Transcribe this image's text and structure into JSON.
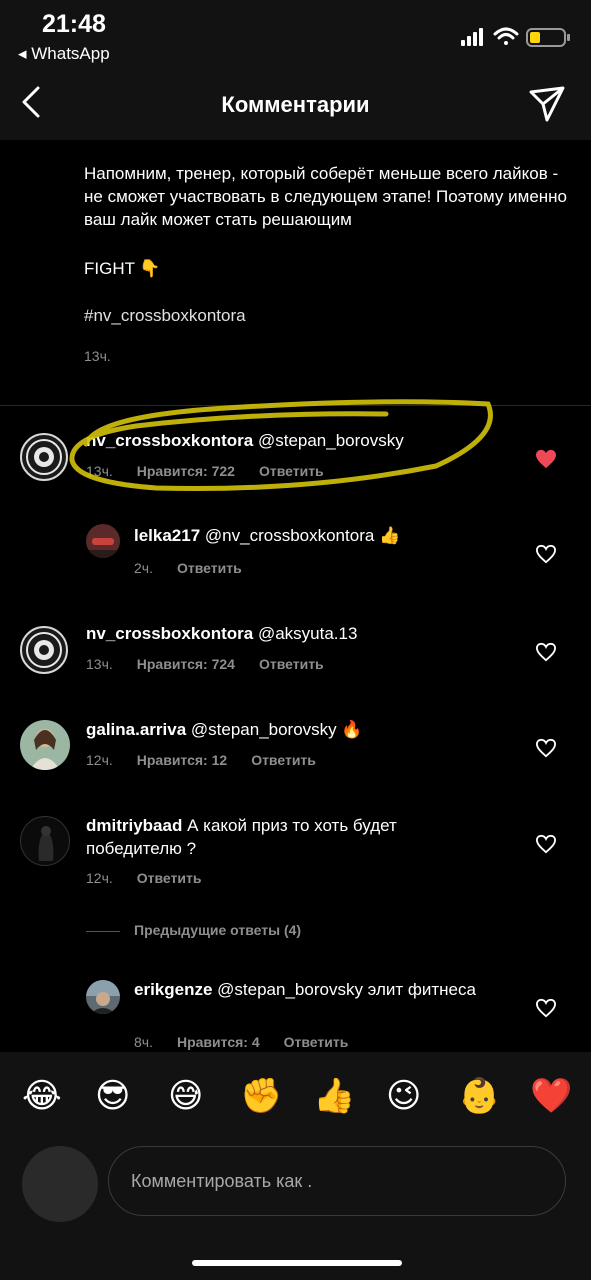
{
  "status_bar": {
    "time": "21:48",
    "back_app": "◂ WhatsApp"
  },
  "nav": {
    "title": "Комментарии"
  },
  "caption": {
    "text": "Напомним, тренер, который соберёт меньше всего лайков - не сможет участвовать в следующем этапе! Поэтому именно ваш лайк может стать решающим",
    "fight": "FIGHT 👇",
    "hashtag": "#nv_crossboxkontora",
    "time": "13ч."
  },
  "comments": [
    {
      "user": "nv_crossboxkontora",
      "text": " @stepan_borovsky",
      "time": "13ч.",
      "likes": "Нравится: 722",
      "reply": "Ответить",
      "liked": true
    },
    {
      "user": "lelka217",
      "text": " @nv_crossboxkontora 👍",
      "time": "2ч.",
      "reply": "Ответить"
    },
    {
      "user": "nv_crossboxkontora",
      "text": " @aksyuta.13",
      "time": "13ч.",
      "likes": "Нравится: 724",
      "reply": "Ответить"
    },
    {
      "user": "galina.arriva",
      "text": " @stepan_borovsky 🔥",
      "time": "12ч.",
      "likes": "Нравится: 12",
      "reply": "Ответить"
    },
    {
      "user": "dmitriybaad",
      "text": " А какой приз то хоть будет победителю ?",
      "time": "12ч.",
      "reply": "Ответить"
    },
    {
      "user": "erikgenze",
      "text": " @stepan_borovsky элит фитнеса",
      "time": "8ч.",
      "likes": "Нравится: 4",
      "reply": "Ответить"
    }
  ],
  "previous_replies": "Предыдущие ответы (4)",
  "emoji_bar": [
    "😂",
    "😎",
    "😅",
    "✊",
    "👍",
    "😉",
    "👶",
    "❤️"
  ],
  "compose": {
    "placeholder": "Комментировать как ."
  },
  "colors": {
    "heart_liked": "#ed4956",
    "highlight": "#d4c20a",
    "muted": "#8e8e8e"
  }
}
